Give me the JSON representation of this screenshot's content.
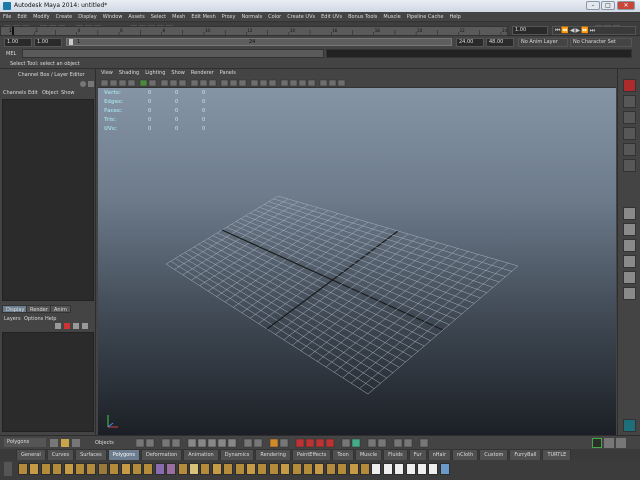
{
  "window": {
    "title": "Autodesk Maya 2014: untitled*"
  },
  "menus": [
    "File",
    "Edit",
    "Modify",
    "Create",
    "Display",
    "Window",
    "Assets",
    "Select",
    "Mesh",
    "Edit Mesh",
    "Proxy",
    "Normals",
    "Color",
    "Create UVs",
    "Edit UVs",
    "Bonus Tools",
    "Muscle",
    "Pipeline Cache",
    "Help"
  ],
  "timeslider": {
    "frame_start_label": "1",
    "frame_end_label": "24",
    "current_frame": "1.00",
    "range_start": "1.00",
    "playback_start": "1.00",
    "range_current": "1",
    "range_end_inner": "24",
    "playback_end": "24.00",
    "range_end": "48.00",
    "anim_layer": "No Anim Layer",
    "character_set": "No Character Set",
    "ticks": [
      "2",
      "4",
      "6",
      "8",
      "10",
      "12",
      "14",
      "16",
      "18",
      "20",
      "22",
      "24"
    ]
  },
  "command": {
    "lang_label": "MEL"
  },
  "help_line": "Select Tool: select an object",
  "channel_box": {
    "header": "Channel Box / Layer Editor",
    "menus": [
      "Channels",
      "Edit",
      "Object",
      "Show"
    ]
  },
  "layer_editor": {
    "tabs": [
      "Display",
      "Render",
      "Anim"
    ],
    "menus": [
      "Layers",
      "Options",
      "Help"
    ]
  },
  "viewport": {
    "menus": [
      "View",
      "Shading",
      "Lighting",
      "Show",
      "Renderer",
      "Panels"
    ],
    "hud": [
      {
        "label": "Verts:",
        "values": [
          "0",
          "0",
          "0"
        ]
      },
      {
        "label": "Edges:",
        "values": [
          "0",
          "0",
          "0"
        ]
      },
      {
        "label": "Faces:",
        "values": [
          "0",
          "0",
          "0"
        ]
      },
      {
        "label": "Tris:",
        "values": [
          "0",
          "0",
          "0"
        ]
      },
      {
        "label": "UVs:",
        "values": [
          "0",
          "0",
          "0"
        ]
      }
    ]
  },
  "shelf": {
    "menuset": "Polygons",
    "objects_label": "Objects",
    "tabs": [
      "General",
      "Curves",
      "Surfaces",
      "Polygons",
      "Deformation",
      "Animation",
      "Dynamics",
      "Rendering",
      "PaintEffects",
      "Toon",
      "Muscle",
      "Fluids",
      "Fur",
      "nHair",
      "nCloth",
      "Custom",
      "FurryBall",
      "TURTLE"
    ],
    "active_tab": "Polygons"
  },
  "colors": {
    "accent": "#6b7d8e",
    "grid_axis": "#1b1b1b",
    "hud_text": "#9fd3e0"
  }
}
